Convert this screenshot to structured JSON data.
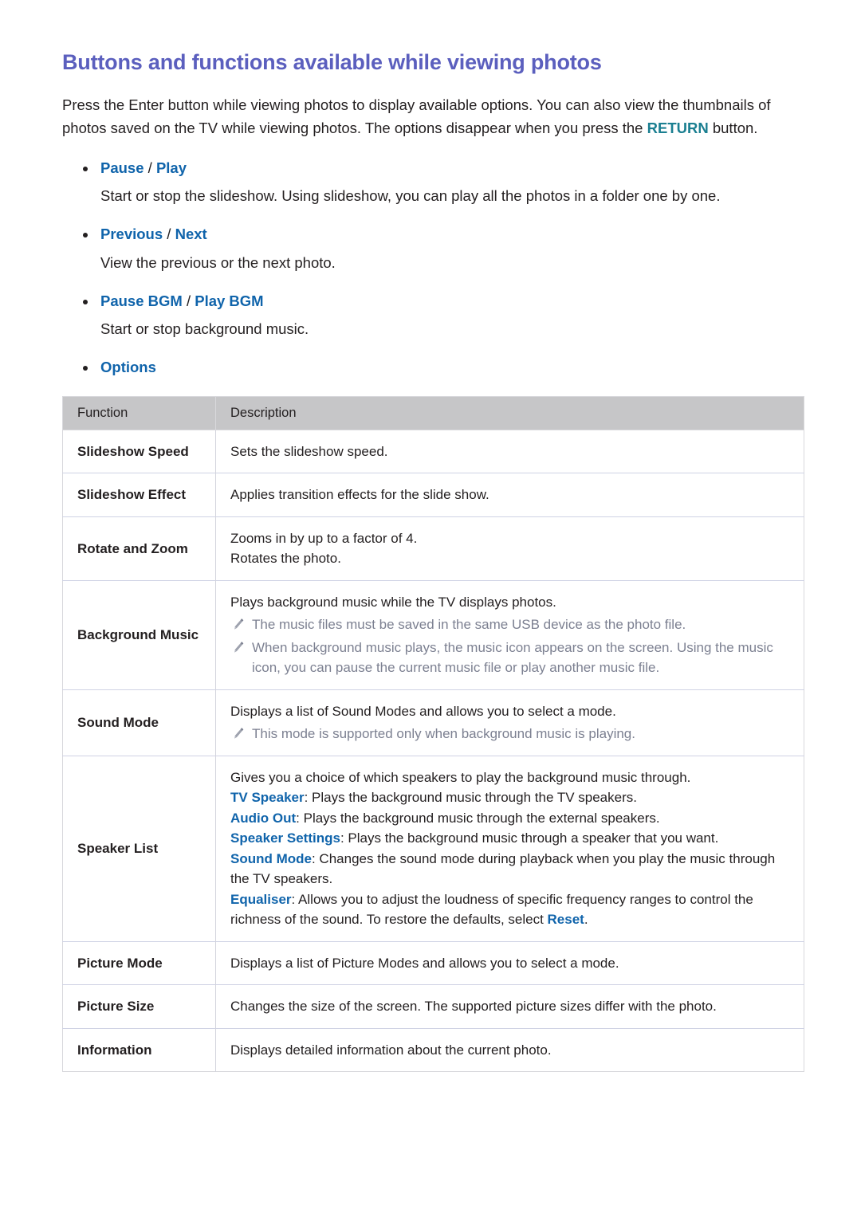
{
  "page": {
    "title": "Buttons and functions available while viewing photos",
    "intro": {
      "before": "Press the Enter button while viewing photos to display available options. You can also view the thumbnails of photos saved on the TV while viewing photos. The options disappear when you press the ",
      "keyword": "RETURN",
      "after": " button."
    }
  },
  "bullets": [
    {
      "term_a": "Pause",
      "separator": " / ",
      "term_b": "Play",
      "body": "Start or stop the slideshow. Using slideshow, you can play all the photos in a folder one by one."
    },
    {
      "term_a": "Previous",
      "separator": " / ",
      "term_b": "Next",
      "body": "View the previous or the next photo."
    },
    {
      "term_a": "Pause BGM",
      "separator": " / ",
      "term_b": "Play BGM",
      "body": "Start or stop background music."
    },
    {
      "term_a": "Options",
      "separator": "",
      "term_b": "",
      "body": ""
    }
  ],
  "table": {
    "headers": {
      "function": "Function",
      "description": "Description"
    },
    "rows": [
      {
        "function": "Slideshow Speed",
        "lines": [
          "Sets the slideshow speed."
        ],
        "notes": []
      },
      {
        "function": "Slideshow Effect",
        "lines": [
          "Applies transition effects for the slide show."
        ],
        "notes": []
      },
      {
        "function": "Rotate and Zoom",
        "lines": [
          "Zooms in by up to a factor of 4.",
          "Rotates the photo."
        ],
        "notes": []
      },
      {
        "function": "Background Music",
        "lines": [
          "Plays background music while the TV displays photos."
        ],
        "notes": [
          "The music files must be saved in the same USB device as the photo file.",
          "When background music plays, the music icon appears on the screen. Using the music icon, you can pause the current music file or play another music file."
        ]
      },
      {
        "function": "Sound Mode",
        "lines": [
          "Displays a list of Sound Modes and allows you to select a mode."
        ],
        "notes": [
          "This mode is supported only when background music is playing."
        ]
      },
      {
        "function": "Picture Mode",
        "lines": [
          "Displays a list of Picture Modes and allows you to select a mode."
        ],
        "notes": []
      },
      {
        "function": "Picture Size",
        "lines": [
          "Changes the size of the screen. The supported picture sizes differ with the photo."
        ],
        "notes": []
      },
      {
        "function": "Information",
        "lines": [
          "Displays detailed information about the current photo."
        ],
        "notes": []
      }
    ],
    "speaker_list_row": {
      "function": "Speaker List",
      "intro_line": "Gives you a choice of which speakers to play the background music through.",
      "items": [
        {
          "term": "TV Speaker",
          "text": ": Plays the background music through the TV speakers."
        },
        {
          "term": "Audio Out",
          "text": ": Plays the background music through the external speakers."
        },
        {
          "term": "Speaker Settings",
          "text": ": Plays the background music through a speaker that you want."
        },
        {
          "term": "Sound Mode",
          "text": ": Changes the sound mode during playback when you play the music through the TV speakers."
        },
        {
          "term": "Equaliser",
          "text_before": ": Allows you to adjust the loudness of specific frequency ranges to control the richness of the sound. To restore the defaults, select ",
          "term_end": "Reset",
          "text_after": "."
        }
      ]
    }
  },
  "colors": {
    "title": "#5b5fbe",
    "link_blue": "#1064ab",
    "keyword_teal": "#1b7f91",
    "note_gray": "#7c8091",
    "table_header_bg": "#c6c6c8",
    "body_text": "#231f20"
  },
  "icons": {
    "note": "pencil-icon",
    "bullet": "bullet-dot-icon"
  }
}
